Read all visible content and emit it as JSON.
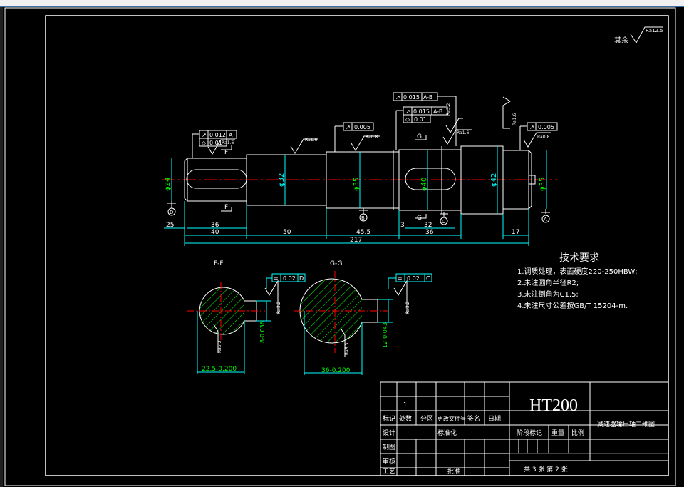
{
  "surface_roughness_general": {
    "label": "其余",
    "value": "Ra12.5"
  },
  "tolerance_frames": [
    {
      "symbol": "↗",
      "value": "0.012",
      "datum": "A"
    },
    {
      "symbol": "◇",
      "value": "0.01",
      "datum": ""
    },
    {
      "symbol": "↗",
      "value": "0.005",
      "datum": ""
    },
    {
      "symbol": "↗",
      "value": "0.015",
      "datum": "A-B"
    },
    {
      "symbol": "↗",
      "value": "0.015",
      "datum": "A-B"
    },
    {
      "symbol": "◇",
      "value": "0.01",
      "datum": ""
    },
    {
      "symbol": "↗",
      "value": "0.005",
      "datum": ""
    },
    {
      "symbol": "=",
      "value": "0.02",
      "datum": "D"
    },
    {
      "symbol": "=",
      "value": "0.02",
      "datum": "C"
    }
  ],
  "roughness_marks": [
    "Ra1.6",
    "Ra1.6",
    "Ra0.8",
    "Ra3.2",
    "Ra1.6",
    "Ra1.6",
    "Ra0.8",
    "Ra3.2",
    "Ra6.3",
    "Ra3.2",
    "Ra6.3"
  ],
  "diameters": [
    "φ24",
    "φ32",
    "φ35",
    "φ40",
    "φ42",
    "φ35"
  ],
  "section_markers": {
    "f": "F",
    "g": "G",
    "f_section": "F-F",
    "g_section": "G-G"
  },
  "datum_markers": [
    "D",
    "B",
    "C",
    "A"
  ],
  "lengths": {
    "l25": "25",
    "l36a": "36",
    "l40": "40",
    "l50": "50",
    "l455": "45.5",
    "l3": "3",
    "l32": "32",
    "l36b": "36",
    "l17": "17",
    "total": "217"
  },
  "section_dims": {
    "ff_width": "22.5-0.200",
    "ff_key": "8-0.036",
    "gg_width": "36-0.200",
    "gg_key": "12-0.043"
  },
  "tech_requirements": {
    "title": "技术要求",
    "items": [
      "1.调质处理，表面硬度220-250HBW;",
      "2.未注圆角半径R2;",
      "3.未注倒角为C1.5;",
      "4.未注尺寸公差按GB/T 15204-m."
    ]
  },
  "title_block": {
    "row1_mark": "1",
    "headers": [
      "标记",
      "处数",
      "分区",
      "更改文件号",
      "签名",
      "日期"
    ],
    "design": "设计",
    "standardize": "标准化",
    "drawing": "制图",
    "review": "审核",
    "process": "工艺",
    "approve": "批准",
    "material": "HT200",
    "name": "减速器输出轴二维图",
    "stage_mark": "阶段标记",
    "weight": "重量",
    "scale": "比例",
    "sheets": "共 3 张  第 2 张"
  }
}
